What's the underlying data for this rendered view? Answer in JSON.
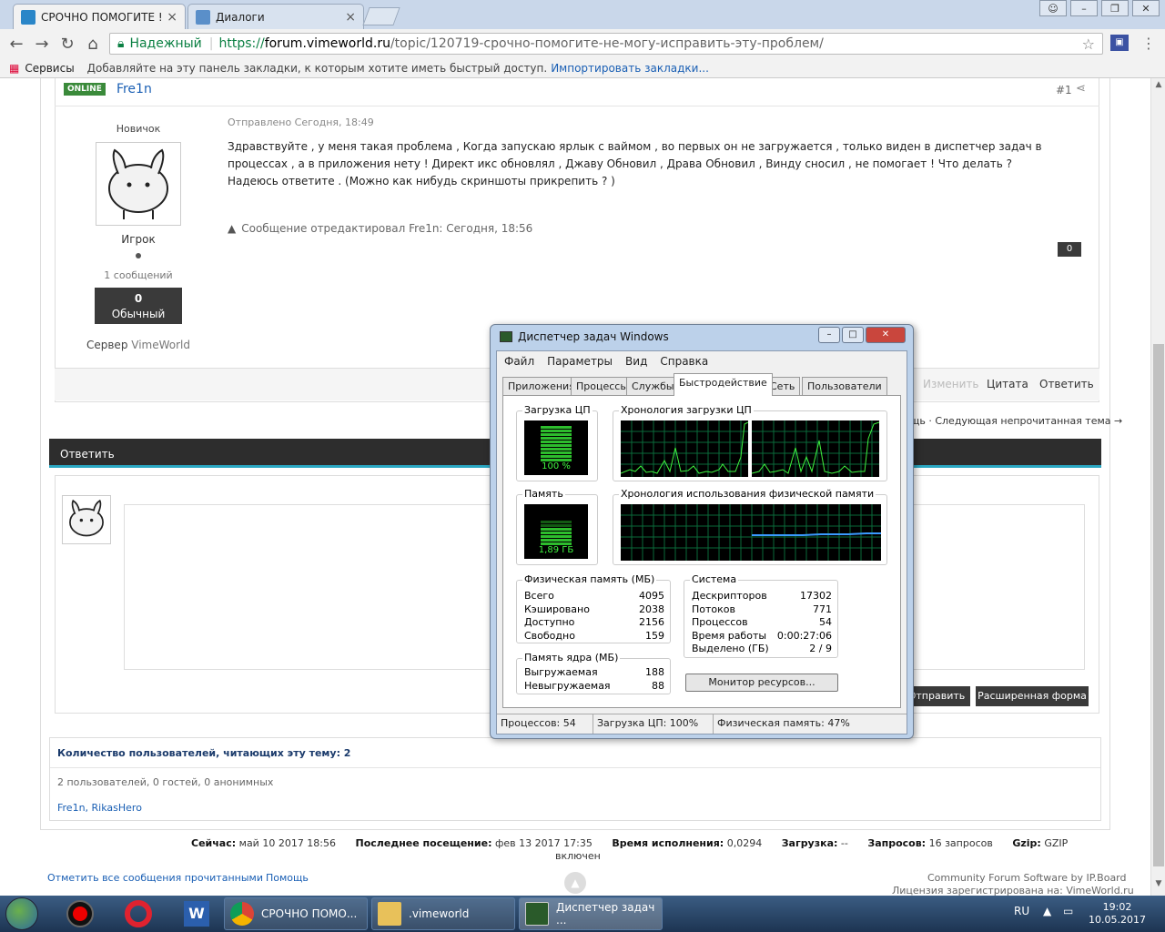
{
  "browser": {
    "tabs": [
      {
        "title": "СРОЧНО ПОМОГИТЕ ! Н"
      },
      {
        "title": "Диалоги"
      }
    ],
    "secure_label": "Надежный",
    "url_scheme": "https://",
    "url_host": "forum.vimeworld.ru",
    "url_path": "/topic/120719-срочно-помогите-не-могу-исправить-эту-проблем/",
    "bookmarks": {
      "apps": "Сервисы",
      "hint": "Добавляйте на эту панель закладки, к которым хотите иметь быстрый доступ.",
      "import": "Импортировать закладки..."
    }
  },
  "post": {
    "online_badge": "ONLINE",
    "author": "Fre1n",
    "post_number": "#1",
    "rank": "Новичок",
    "group": "Игрок",
    "message_count": "1 сообщений",
    "reputation_value": "0",
    "reputation_label": "Обычный",
    "server_prefix": "Сервер",
    "server_name": "VimeWorld",
    "posted": "Отправлено Сегодня, 18:49",
    "body": "Здравствуйте , у меня такая проблема , Когда запускаю ярлык с ваймом , во первых он не загружается , только виден в диспетчер задач в процессах , а в приложения нету ! Директ икс обновлял , Джаву Обновил , Драва Обновил , Винду сносил , не помогает ! Что делать ? Надеюсь ответите . (Можно как нибудь скриншоты прикрепить ? )",
    "edited": "Сообщение отредактировал Fre1n: Сегодня, 18:56",
    "likes": "0",
    "actions": {
      "edit": "Изменить",
      "quote": "Цитата",
      "reply": "Ответить"
    }
  },
  "nav": {
    "next": "щь · Следующая непрочитанная тема →"
  },
  "reply": {
    "title": "Ответить",
    "send": "Отправить",
    "extended": "Расширенная форма"
  },
  "readers": {
    "heading": "Количество пользователей, читающих эту тему: 2",
    "counts": "2 пользователей, 0 гостей, 0 анонимных",
    "users": "Fre1n, RikasHero"
  },
  "stats": {
    "now_label": "Сейчас:",
    "now": "май 10 2017 18:56",
    "last_label": "Последнее посещение:",
    "last": "фев 13 2017 17:35",
    "exec_label": "Время исполнения:",
    "exec": "0,0294",
    "load_label": "Загрузка:",
    "load": "--",
    "queries_label": "Запросов:",
    "queries": "16 запросов",
    "gzip_label": "Gzip:",
    "gzip": "GZIP",
    "gzip_state": "включен"
  },
  "footer": {
    "mark_read": "Отметить все сообщения прочитанными",
    "help": "Помощь",
    "software": "Community Forum Software by IP.Board",
    "license": "Лицензия зарегистрирована на: VimeWorld.ru"
  },
  "taskmgr": {
    "title": "Диспетчер задач Windows",
    "menu": [
      "Файл",
      "Параметры",
      "Вид",
      "Справка"
    ],
    "tabs": [
      "Приложения",
      "Процессы",
      "Службы",
      "Быстродействие",
      "Сеть",
      "Пользователи"
    ],
    "cpu_label": "Загрузка ЦП",
    "cpu_value": "100 %",
    "cpu_history_label": "Хронология загрузки ЦП",
    "mem_label": "Память",
    "mem_value": "1,89 ГБ",
    "mem_history_label": "Хронология использования физической памяти",
    "physical": {
      "label": "Физическая память (МБ)",
      "rows": [
        {
          "k": "Всего",
          "v": "4095"
        },
        {
          "k": "Кэшировано",
          "v": "2038"
        },
        {
          "k": "Доступно",
          "v": "2156"
        },
        {
          "k": "Свободно",
          "v": "159"
        }
      ]
    },
    "kernel": {
      "label": "Память ядра (МБ)",
      "rows": [
        {
          "k": "Выгружаемая",
          "v": "188"
        },
        {
          "k": "Невыгружаемая",
          "v": "88"
        }
      ]
    },
    "system": {
      "label": "Система",
      "rows": [
        {
          "k": "Дескрипторов",
          "v": "17302"
        },
        {
          "k": "Потоков",
          "v": "771"
        },
        {
          "k": "Процессов",
          "v": "54"
        },
        {
          "k": "Время работы",
          "v": "0:00:27:06"
        },
        {
          "k": "Выделено (ГБ)",
          "v": "2 / 9"
        }
      ]
    },
    "monitor_button": "Монитор ресурсов...",
    "status": {
      "processes": "Процессов: 54",
      "cpu": "Загрузка ЦП: 100%",
      "memory": "Физическая память: 47%"
    }
  },
  "taskbar": {
    "items": [
      "СРОЧНО ПОМО...",
      ".vimeworld",
      "Диспетчер задач ..."
    ],
    "lang": "RU",
    "time": "19:02",
    "date": "10.05.2017"
  }
}
